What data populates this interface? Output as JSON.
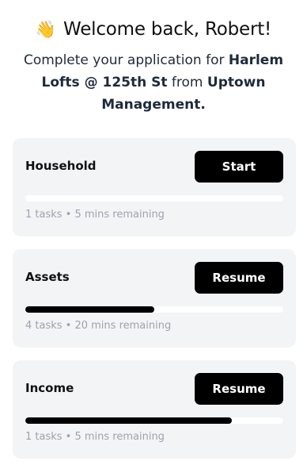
{
  "header": {
    "wave_emoji": "👋",
    "welcome": "Welcome back, Robert!",
    "subtitle_prefix": "Complete your application for ",
    "property_name": "Harlem Lofts @ 125th St",
    "subtitle_mid": " from ",
    "company_name": "Uptown Management."
  },
  "sections": [
    {
      "title": "Household",
      "button_label": "Start",
      "progress": 0,
      "meta": "1 tasks • 5 mins remaining"
    },
    {
      "title": "Assets",
      "button_label": "Resume",
      "progress": 0.5,
      "meta": "4 tasks • 20 mins remaining"
    },
    {
      "title": "Income",
      "button_label": "Resume",
      "progress": 0.8,
      "meta": "1 tasks • 5 mins remaining"
    }
  ],
  "colors": {
    "card_bg": "#f3f4f6",
    "button_bg": "#000000",
    "progress_fill": "#000000",
    "meta_text": "#9ca3af"
  }
}
